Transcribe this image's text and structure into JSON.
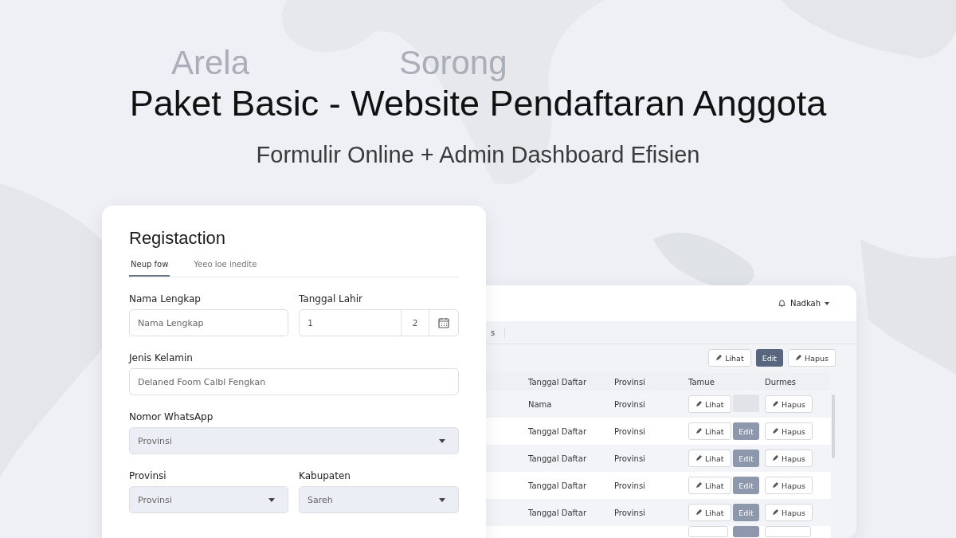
{
  "map_labels": [
    "Arela",
    "Sorong"
  ],
  "headline": "Paket Basic - Website Pendaftaran Anggota",
  "subheadline": "Formulir Online + Admin Dashboard Efisien",
  "form": {
    "title": "Registaction",
    "tabs": [
      {
        "label": "Neup fow",
        "selected": true
      },
      {
        "label": "Yeeo loe inedite",
        "selected": false
      }
    ],
    "rows": [
      [
        {
          "kind": "text",
          "label": "Nama Lengkap",
          "placeholder": "Nama Lengkap"
        },
        {
          "kind": "date",
          "label": "Tanggal Lahir",
          "value": "1",
          "value_2": "2"
        }
      ],
      [
        {
          "kind": "text",
          "label": "Jenis Kelamin",
          "placeholder": "Delaned Foom Calbl Fengkan"
        }
      ],
      [
        {
          "kind": "select",
          "label": "Nomor WhatsApp",
          "placeholder": "Provinsi"
        }
      ],
      [
        {
          "kind": "select",
          "label": "Provinsi",
          "placeholder": "Provinsi"
        },
        {
          "kind": "select",
          "label": "Kabupaten",
          "placeholder": "Sareh"
        }
      ]
    ]
  },
  "dashboard": {
    "user": "Nadkah",
    "tab": "s",
    "toolbar": [
      {
        "label": "Lihat",
        "kind": "outline"
      },
      {
        "label": "Edit",
        "kind": "primary"
      },
      {
        "label": "Hapus",
        "kind": "outline"
      }
    ],
    "columns": [
      "Tanggal Daftar",
      "Provinsi",
      "Tamue",
      "Durmes"
    ],
    "rows": [
      {
        "date": "Nama",
        "province": "Provinsi",
        "view": "Lihat",
        "edit": "",
        "edit_disabled": false,
        "delete": "Hapus"
      },
      {
        "date": "Tanggal Daftar",
        "province": "Provinsi",
        "view": "Lihat",
        "edit": "Edit",
        "edit_disabled": true,
        "delete": "Hapus"
      },
      {
        "date": "Tanggal Daftar",
        "province": "Provinsi",
        "view": "Lihat",
        "edit": "Edit",
        "edit_disabled": true,
        "delete": "Hapus"
      },
      {
        "date": "Tanggal Daftar",
        "province": "Provinsi",
        "view": "Lihat",
        "edit": "Edit",
        "edit_disabled": true,
        "delete": "Hapus"
      },
      {
        "date": "Tanggal Daftar",
        "province": "Provinsi",
        "view": "Lihat",
        "edit": "Edit",
        "edit_disabled": true,
        "delete": "Hapus"
      }
    ]
  }
}
